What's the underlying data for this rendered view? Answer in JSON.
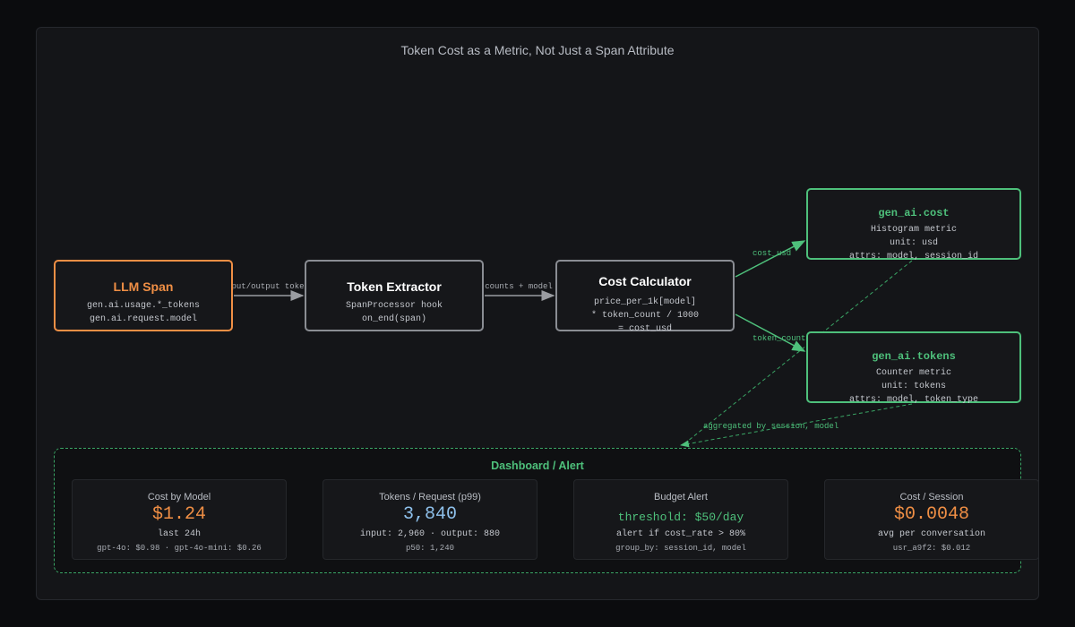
{
  "title": "Token Cost as a Metric, Not Just a Span Attribute",
  "nodes": {
    "llm_span": {
      "title": "LLM Span",
      "lines": [
        "gen.ai.usage.*_tokens",
        "gen.ai.request.model"
      ]
    },
    "token_extractor": {
      "title": "Token Extractor",
      "lines": [
        "SpanProcessor hook",
        "on_end(span)"
      ]
    },
    "cost_calculator": {
      "title": "Cost Calculator",
      "lines": [
        "price_per_1k[model]",
        "* token_count / 1000",
        "= cost_usd"
      ]
    },
    "cost_metric": {
      "title": "gen_ai.cost",
      "lines": [
        "Histogram metric",
        "unit: usd",
        "attrs: model, session_id"
      ]
    },
    "tokens_metric": {
      "title": "gen_ai.tokens",
      "lines": [
        "Counter metric",
        "unit: tokens",
        "attrs: model, token_type"
      ]
    }
  },
  "edges": {
    "span_to_extractor": "input/output tokens",
    "extractor_to_calculator": "counts + model",
    "calculator_to_cost": "cost_usd",
    "calculator_to_tokens": "token_counts",
    "metrics_to_dashboard": "aggregated by session, model"
  },
  "dashboard": {
    "title": "Dashboard / Alert",
    "cards": [
      {
        "title": "Cost by Model",
        "value": "$1.24",
        "sub": "last 24h",
        "detail": "gpt-4o: $0.98 · gpt-4o-mini: $0.26"
      },
      {
        "title": "Tokens / Request (p99)",
        "value": "3,840",
        "sub": "input: 2,960 · output: 880",
        "detail": "p50: 1,240"
      },
      {
        "title": "Budget Alert",
        "value": "threshold: $50/day",
        "sub": "alert if cost_rate > 80%",
        "detail": "group_by: session_id, model"
      },
      {
        "title": "Cost / Session",
        "value": "$0.0048",
        "sub": "avg per conversation",
        "detail": "usr_a9f2: $0.012"
      }
    ]
  },
  "colors": {
    "orange": "#f08f45",
    "green": "#4ec07b",
    "blue": "#8fc1ec",
    "gray": "#8a8d93"
  }
}
